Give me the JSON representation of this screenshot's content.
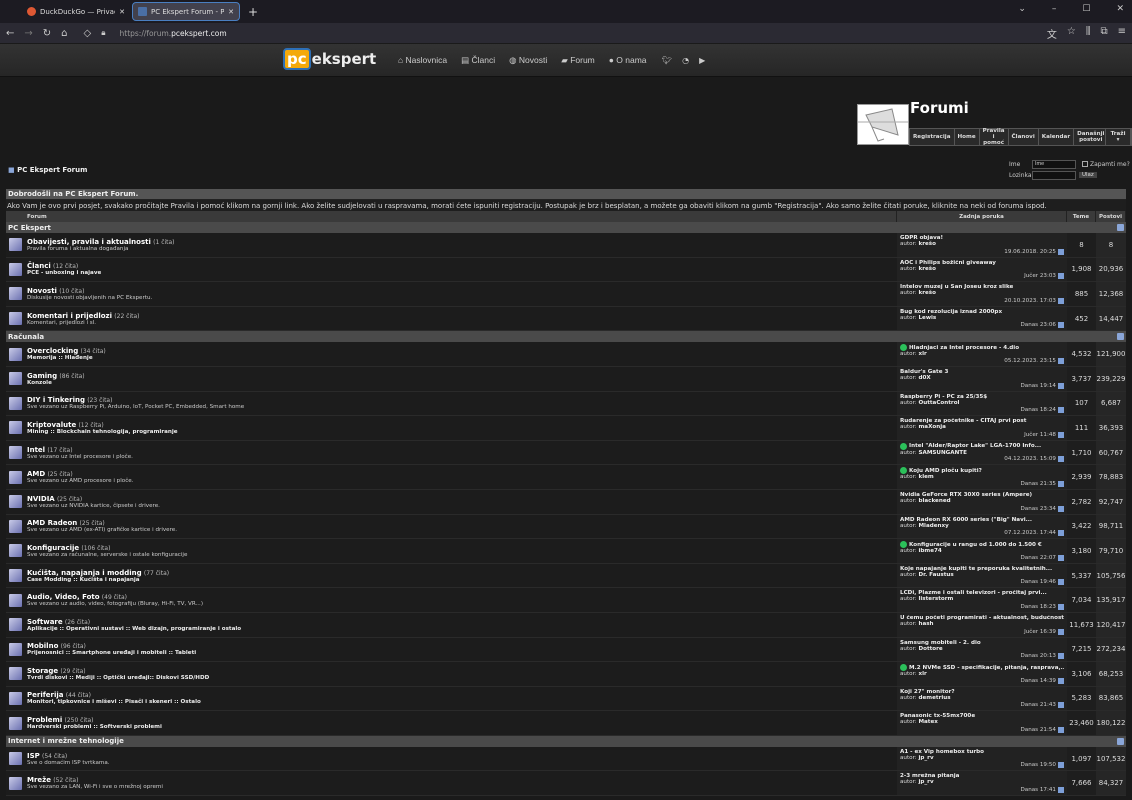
{
  "browser": {
    "tabs": [
      {
        "title": "DuckDuckGo — Privacy, simplified",
        "color": "#de5833"
      },
      {
        "title": "PC Ekspert Forum - Podupire vB",
        "color": "#4a6fa5"
      }
    ],
    "url_prefix": "https://forum.",
    "url_domain": "pcekspert.com"
  },
  "site": {
    "logo_pc": "pc",
    "logo_rest": "ekspert",
    "nav": [
      "Naslovnica",
      "Članci",
      "Novosti",
      "Forum",
      "O nama"
    ]
  },
  "forum": {
    "title": "Forumi",
    "toplinks": [
      "Registracija",
      "Home",
      "Pravila i pomoć",
      "Članovi",
      "Kalendar",
      "Današnji postovi",
      "Traži ▾"
    ],
    "breadcrumb": "PC Ekspert Forum",
    "login": {
      "user_label": "Ime",
      "user_placeholder": "Ime",
      "remember": "Zapamti me?",
      "pass_label": "Lozinka",
      "submit": "Ulaz"
    },
    "welcome_title": "Dobrodošli na PC Ekspert Forum.",
    "welcome_text": "Ako Vam je ovo prvi posjet, svakako pročitajte Pravila i pomoć klikom na gornji link. Ako želite sudjelovati u raspravama, morati ćete ispuniti registraciju. Postupak je brz i besplatan, a možete ga obaviti klikom na gumb \"Registracija\". Ako samo želite čitati poruke, kliknite na neki od foruma ispod.",
    "columns": [
      "Forum",
      "Zadnja poruka",
      "Teme",
      "Postovi"
    ],
    "categories": [
      {
        "name": "PC Ekspert",
        "forums": [
          {
            "name": "Obavijesti, pravila i aktualnosti",
            "count": "(1 čita)",
            "desc": "Pravila foruma i aktualna događanja",
            "bold": false,
            "last": "GDPR objava!",
            "author": "krešo",
            "time": "19.06.2018. 20:25",
            "new": false,
            "topics": "8",
            "posts": "8"
          },
          {
            "name": "Članci",
            "count": "(12 čita)",
            "desc": "PCE - unboxing i najave",
            "bold": true,
            "last": "AOC i Philips božični giveaway",
            "author": "krešo",
            "time": "Jučer 23:03",
            "new": false,
            "topics": "1,908",
            "posts": "20,936"
          },
          {
            "name": "Novosti",
            "count": "(10 čita)",
            "desc": "Diskusije novosti objavljenih na PC Ekspertu.",
            "bold": false,
            "last": "Intelov muzej u San Joseu kroz slike",
            "author": "krešo",
            "time": "20.10.2023. 17:03",
            "new": false,
            "topics": "885",
            "posts": "12,368"
          },
          {
            "name": "Komentari i prijedlozi",
            "count": "(22 čita)",
            "desc": "Komentari, prijedlozi i sl.",
            "bold": false,
            "last": "Bug kod rezolucija iznad 2000px",
            "author": "Lewis",
            "time": "Danas 23:06",
            "new": false,
            "topics": "452",
            "posts": "14,447"
          }
        ]
      },
      {
        "name": "Računala",
        "forums": [
          {
            "name": "Overclocking",
            "count": "(34 čita)",
            "desc": "Memorija :: Hlađenje",
            "bold": true,
            "last": "Hladnjaci za Intel procesore - 4.dio",
            "author": "xlr",
            "time": "05.12.2023. 23:15",
            "new": true,
            "topics": "4,532",
            "posts": "121,900"
          },
          {
            "name": "Gaming",
            "count": "(86 čita)",
            "desc": "Konzole",
            "bold": true,
            "last": "Baldur's Gate 3",
            "author": "d0X",
            "time": "Danas 19:14",
            "new": false,
            "topics": "3,737",
            "posts": "239,229"
          },
          {
            "name": "DIY i Tinkering",
            "count": "(23 čita)",
            "desc": "Sve vezano uz Raspberry Pi, Arduino, IoT, Pocket PC, Embedded, Smart home",
            "bold": false,
            "last": "Raspberry Pi - PC za 25/35$",
            "author": "OuttaControl",
            "time": "Danas 18:24",
            "new": false,
            "topics": "107",
            "posts": "6,687"
          },
          {
            "name": "Kriptovalute",
            "count": "(12 čita)",
            "desc": "Mining :: Blockchain tehnologija, programiranje",
            "bold": true,
            "last": "Rudarenje za početnike - ČITAJ prvi post",
            "author": "maXonja",
            "time": "Jučer 11:48",
            "new": false,
            "topics": "111",
            "posts": "36,393"
          },
          {
            "name": "Intel",
            "count": "(17 čita)",
            "desc": "Sve vezano uz Intel procesore i ploče.",
            "bold": false,
            "last": "Intel \"Alder/Raptor Lake\" LGA-1700 Info...",
            "author": "SAMSUNGANTE",
            "time": "04.12.2023. 15:09",
            "new": true,
            "topics": "1,710",
            "posts": "60,767"
          },
          {
            "name": "AMD",
            "count": "(25 čita)",
            "desc": "Sve vezano uz AMD procesore i ploče.",
            "bold": false,
            "last": "Koju AMD ploču kupiti?",
            "author": "klem",
            "time": "Danas 21:35",
            "new": true,
            "topics": "2,939",
            "posts": "78,883"
          },
          {
            "name": "NVIDIA",
            "count": "(25 čita)",
            "desc": "Sve vezano uz NVIDIA kartice, čipsete i drivere.",
            "bold": false,
            "last": "Nvidia GeForce RTX 30X0 series (Ampere)",
            "author": "blackened",
            "time": "Danas 23:34",
            "new": false,
            "topics": "2,782",
            "posts": "92,747"
          },
          {
            "name": "AMD Radeon",
            "count": "(25 čita)",
            "desc": "Sve vezano uz AMD (ex-ATI) grafičke kartice i drivere.",
            "bold": false,
            "last": "AMD Radeon RX 6000 series (\"Big\" Navi...",
            "author": "Mladenxy",
            "time": "07.12.2023. 17:44",
            "new": false,
            "topics": "3,422",
            "posts": "98,711"
          },
          {
            "name": "Konfiguracije",
            "count": "(106 čita)",
            "desc": "Sve vezano za računalne, serverske i ostale konfiguracije",
            "bold": false,
            "last": "Konfiguracije u rangu od 1.000 do 1.500 €",
            "author": "ibme74",
            "time": "Danas 22:07",
            "new": true,
            "topics": "3,180",
            "posts": "79,710"
          },
          {
            "name": "Kućišta, napajanja i modding",
            "count": "(77 čita)",
            "desc": "Case Modding :: Kućišta i napajanja",
            "bold": true,
            "last": "Koje napajanje kupiti te preporuka kvalitetnih...",
            "author": "Dr. Faustus",
            "time": "Danas 19:46",
            "new": false,
            "topics": "5,337",
            "posts": "105,756"
          },
          {
            "name": "Audio, Video, Foto",
            "count": "(49 čita)",
            "desc": "Sve vezano uz audio, video, fotografiju (Bluray, Hi-Fi, TV, VR...)",
            "bold": false,
            "last": "LCDi, Plazme i ostali televizori - pročitaj prvi...",
            "author": "listerstorm",
            "time": "Danas 18:23",
            "new": false,
            "topics": "7,034",
            "posts": "135,917"
          },
          {
            "name": "Software",
            "count": "(26 čita)",
            "desc": "Aplikacije :: Operativni sustavi :: Web dizajn, programiranje i ostalo",
            "bold": true,
            "last": "U čemu početi programirati - aktualnost, budućnost",
            "author": "hash",
            "time": "Jučer 16:39",
            "new": false,
            "topics": "11,673",
            "posts": "120,417"
          },
          {
            "name": "Mobilno",
            "count": "(96 čita)",
            "desc": "Prijenosnici :: Smartphone uređaji i mobiteli :: Tableti",
            "bold": true,
            "last": "Samsung mobiteli - 2. dio",
            "author": "Dottore",
            "time": "Danas 20:13",
            "new": false,
            "topics": "7,215",
            "posts": "272,234"
          },
          {
            "name": "Storage",
            "count": "(29 čita)",
            "desc": "Tvrdi diskovi :: Mediji :: Optički uređaji:: Diskovi SSD/HDD",
            "bold": true,
            "last": "M.2 NVMe SSD - specifikacije, pitanja, rasprava,...",
            "author": "xlr",
            "time": "Danas 14:39",
            "new": true,
            "topics": "3,106",
            "posts": "68,253"
          },
          {
            "name": "Periferija",
            "count": "(44 čita)",
            "desc": "Monitori, tipkovnice i miševi :: Pisači i skeneri :: Ostalo",
            "bold": true,
            "last": "Koji 27\" monitor?",
            "author": "demetrius",
            "time": "Danas 21:43",
            "new": false,
            "topics": "5,283",
            "posts": "83,865"
          },
          {
            "name": "Problemi",
            "count": "(250 čita)",
            "desc": "Hardverski problemi :: Softverski problemi",
            "bold": true,
            "last": "Panasonic tx-55mx700e",
            "author": "Matex",
            "time": "Danas 21:54",
            "new": false,
            "topics": "23,460",
            "posts": "180,122"
          }
        ]
      },
      {
        "name": "Internet i mrežne tehnologije",
        "forums": [
          {
            "name": "ISP",
            "count": "(54 čita)",
            "desc": "Sve o domaćim ISP tvrtkama.",
            "bold": false,
            "last": "A1 - ex Vip homebox turbo",
            "author": "jp_rv",
            "time": "Danas 19:50",
            "new": false,
            "topics": "1,097",
            "posts": "107,532"
          },
          {
            "name": "Mreže",
            "count": "(52 čita)",
            "desc": "Sve vezano za LAN, Wi-Fi i sve o mrežnoj opremi",
            "bold": false,
            "last": "2-3 mrežna pitanja",
            "author": "jp_rv",
            "time": "Danas 17:41",
            "new": false,
            "topics": "7,666",
            "posts": "84,327"
          }
        ]
      }
    ],
    "author_prefix": "autor:"
  }
}
